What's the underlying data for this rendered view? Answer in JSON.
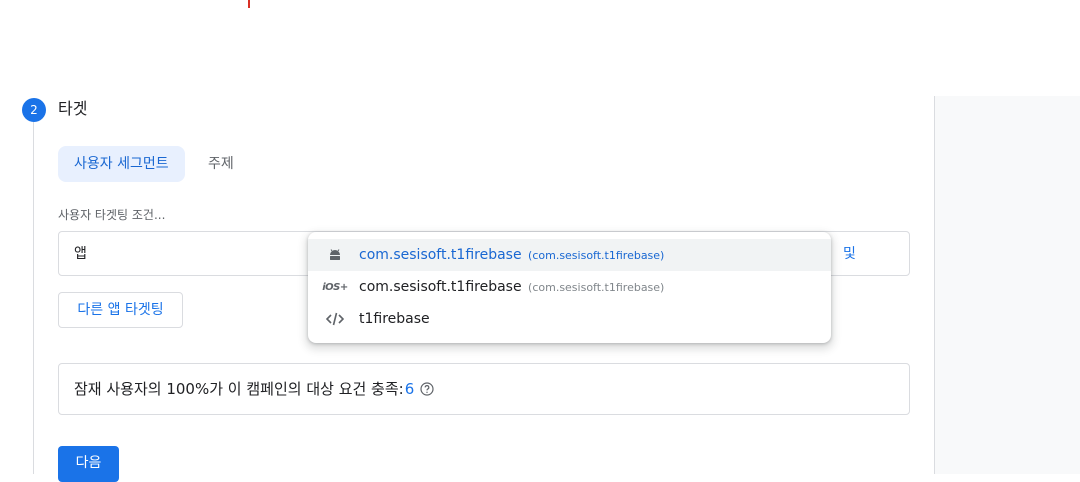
{
  "step": {
    "number": "2",
    "title": "타겟"
  },
  "tabs": [
    {
      "label": "사용자 세그먼트",
      "active": true
    },
    {
      "label": "주제",
      "active": false
    }
  ],
  "targeting": {
    "label": "사용자 타겟팅 조건...",
    "condition_value": "앱",
    "and_label": "및",
    "other_app_button": "다른 앱 타겟팅"
  },
  "dropdown": {
    "items": [
      {
        "icon": "android-icon",
        "name": "com.sesisoft.t1firebase",
        "sub": "(com.sesisoft.t1firebase)",
        "selected": true
      },
      {
        "icon": "ios-icon",
        "name": "com.sesisoft.t1firebase",
        "sub": "(com.sesisoft.t1firebase)",
        "selected": false
      },
      {
        "icon": "code-icon",
        "name": "t1firebase",
        "sub": "",
        "selected": false
      }
    ]
  },
  "potential": {
    "text": "잠재 사용자의 100%가 이 캠페인의 대상 요건 충족:",
    "count": "6"
  },
  "next_button": "다음",
  "colors": {
    "accent": "#1a73e8",
    "tab_active_bg": "#e8f0fe"
  }
}
